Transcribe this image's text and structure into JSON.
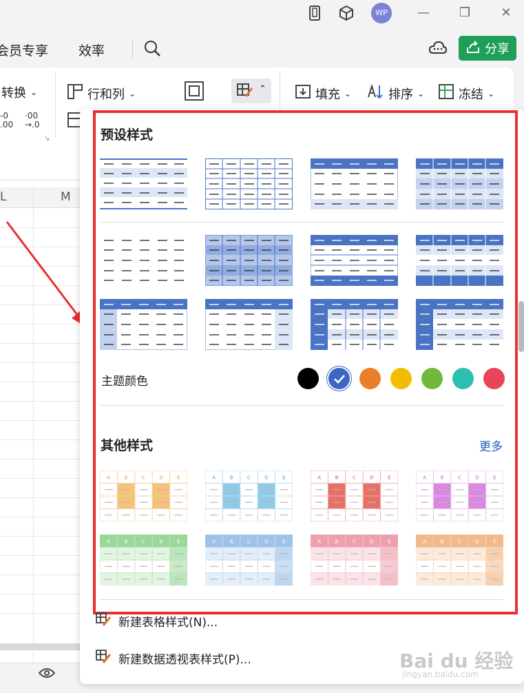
{
  "titlebar": {
    "avatar": "WP",
    "minimize": "—",
    "restore": "❐",
    "close": "✕"
  },
  "menubar": {
    "items": [
      "会员专享",
      "效率"
    ],
    "share_label": "分享"
  },
  "ribbon": {
    "convert_label": "转换",
    "rows_cols_label": "行和列",
    "fill_label": "填充",
    "sort_label": "排序",
    "freeze_label": "冻结",
    "dec_a": "-0\n.00",
    "dec_b": "·00\n→.0"
  },
  "sheet": {
    "col_left": "L",
    "col_m": "M"
  },
  "panel": {
    "preset_title": "预设样式",
    "theme_color_label": "主题颜色",
    "other_title": "其他样式",
    "more_label": "更多",
    "new_table_style": "新建表格样式(N)...",
    "new_pivot_style": "新建数据透视表样式(P)..."
  },
  "theme_colors": [
    "#000000",
    "#3a66c4",
    "#ee7d28",
    "#f3bc00",
    "#6fba3a",
    "#2ebfb0",
    "#e64657"
  ],
  "other_thumb_letters": [
    "A",
    "B",
    "C",
    "D",
    "E"
  ],
  "watermark": {
    "brand": "Bai du 经验",
    "url": "jingyan.baidu.com"
  }
}
